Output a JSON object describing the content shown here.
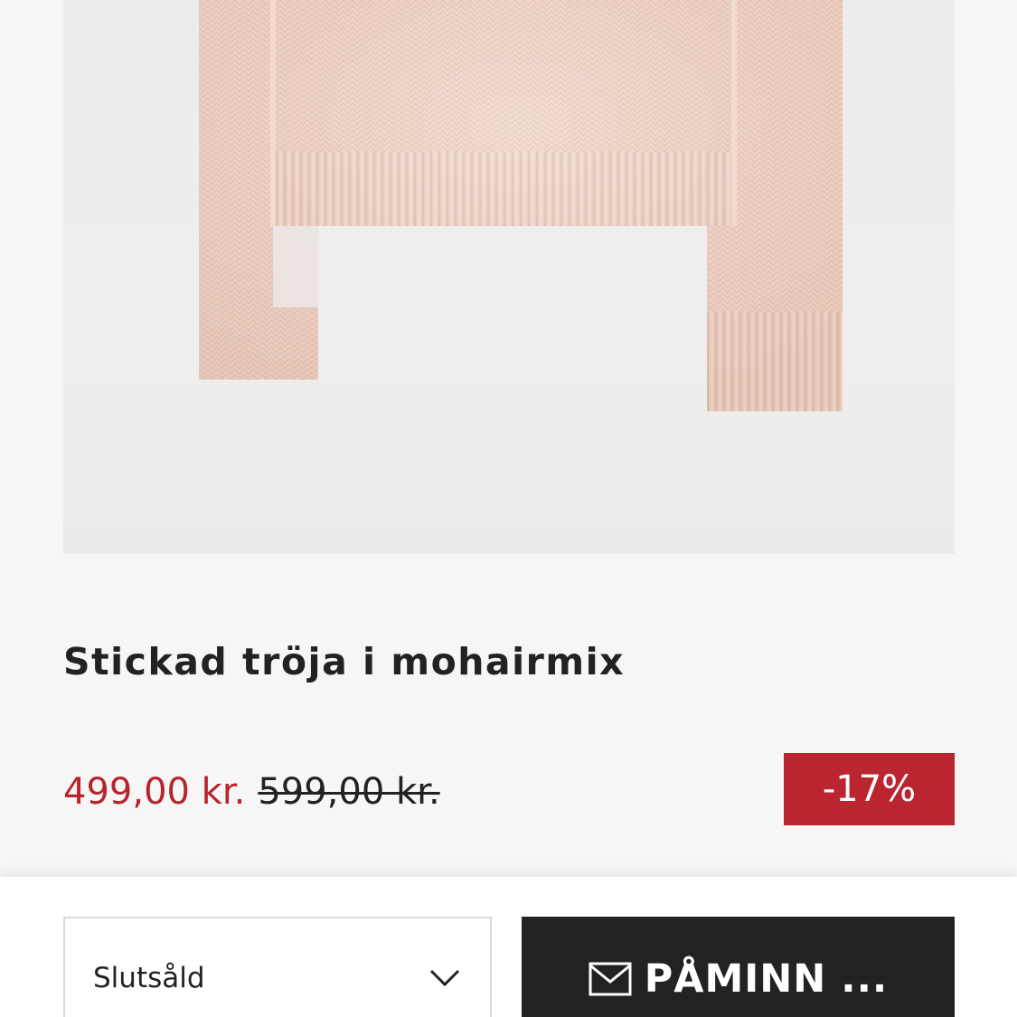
{
  "product": {
    "image_alt": "Stickad tröja i mohairmix",
    "title": "Stickad tröja i mohairmix",
    "price_sale": "499,00 kr.",
    "price_original": "599,00 kr.",
    "discount": "-17%"
  },
  "purchase_bar": {
    "size_select_value": "Slutsåld",
    "remind_button_label": "PÅMINN ..."
  },
  "icons": {
    "select_chevron": "chevron-down-icon",
    "remind": "mail-icon"
  },
  "colors": {
    "sale_price": "#b8242c",
    "badge_background": "#bb2530",
    "button_background": "#222222",
    "page_background": "#f7f6f6"
  }
}
